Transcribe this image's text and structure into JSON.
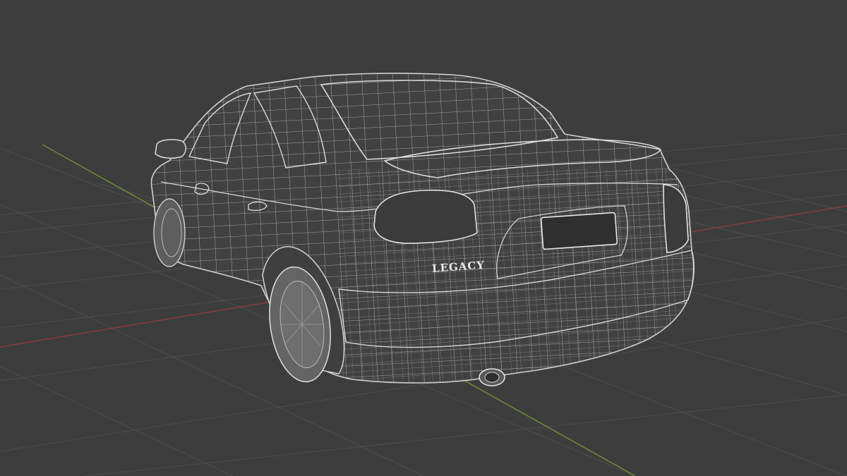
{
  "viewport": {
    "background": "#3d3d3d",
    "grid_color": "#4e4e4e",
    "x_axis_color": "#8a3a40",
    "y_axis_color": "#6f8a36"
  },
  "model": {
    "wire_color": "#c9c9c9",
    "fill_color": "#414141",
    "badge_text": "LEGACY"
  }
}
